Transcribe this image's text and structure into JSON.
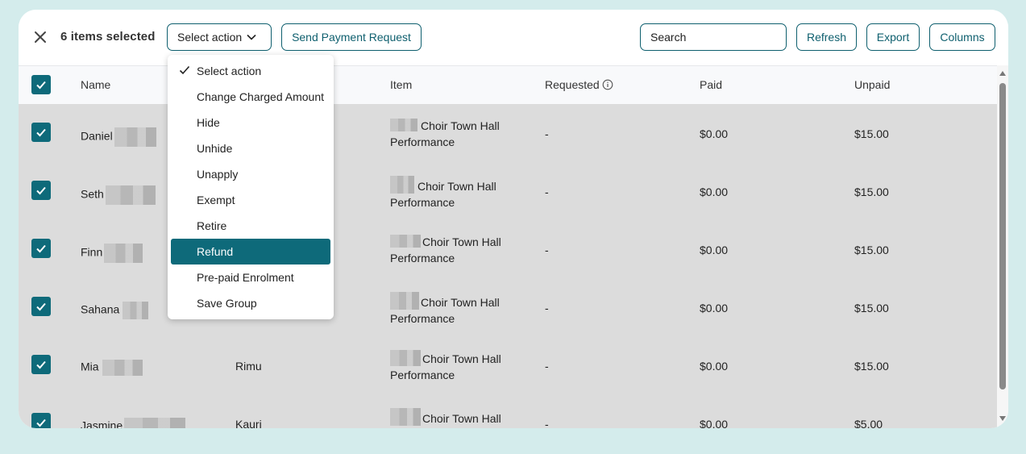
{
  "toolbar": {
    "selection_count": "6 items selected",
    "select_action_label": "Select action",
    "send_payment_label": "Send Payment Request",
    "search_placeholder": "Search",
    "refresh_label": "Refresh",
    "export_label": "Export",
    "columns_label": "Columns"
  },
  "table": {
    "headers": {
      "name": "Name",
      "item": "Item",
      "requested": "Requested",
      "paid": "Paid",
      "unpaid": "Unpaid"
    },
    "rows": [
      {
        "name": "Daniel",
        "group": "",
        "item_line1": "Choir Town Hall",
        "item_line2": "Performance",
        "requested": "-",
        "paid": "$0.00",
        "unpaid": "$15.00"
      },
      {
        "name": "Seth",
        "group": "",
        "item_line1": "Choir Town Hall",
        "item_line2": "Performance",
        "requested": "-",
        "paid": "$0.00",
        "unpaid": "$15.00"
      },
      {
        "name": "Finn",
        "group": "",
        "item_line1": "Choir Town Hall",
        "item_line2": "Performance",
        "requested": "-",
        "paid": "$0.00",
        "unpaid": "$15.00"
      },
      {
        "name": "Sahana",
        "group": "",
        "item_line1": "Choir Town Hall",
        "item_line2": "Performance",
        "requested": "-",
        "paid": "$0.00",
        "unpaid": "$15.00"
      },
      {
        "name": "Mia",
        "group": "Rimu",
        "item_line1": "Choir Town Hall",
        "item_line2": "Performance",
        "requested": "-",
        "paid": "$0.00",
        "unpaid": "$15.00"
      },
      {
        "name": "Jasmine",
        "group": "Kauri",
        "item_line1": "Choir Town Hall",
        "item_line2": "",
        "requested": "-",
        "paid": "$0.00",
        "unpaid": "$5.00"
      }
    ]
  },
  "action_menu": {
    "items": [
      {
        "label": "Select action",
        "checked": true
      },
      {
        "label": "Change Charged Amount"
      },
      {
        "label": "Hide"
      },
      {
        "label": "Unhide"
      },
      {
        "label": "Unapply"
      },
      {
        "label": "Exempt"
      },
      {
        "label": "Retire"
      },
      {
        "label": "Refund",
        "highlighted": true
      },
      {
        "label": "Pre-paid Enrolment"
      },
      {
        "label": "Save Group"
      }
    ]
  },
  "colors": {
    "accent": "#0e6a7a",
    "page_background": "#d4ecec",
    "row_overlay": "#dcdcdc"
  }
}
